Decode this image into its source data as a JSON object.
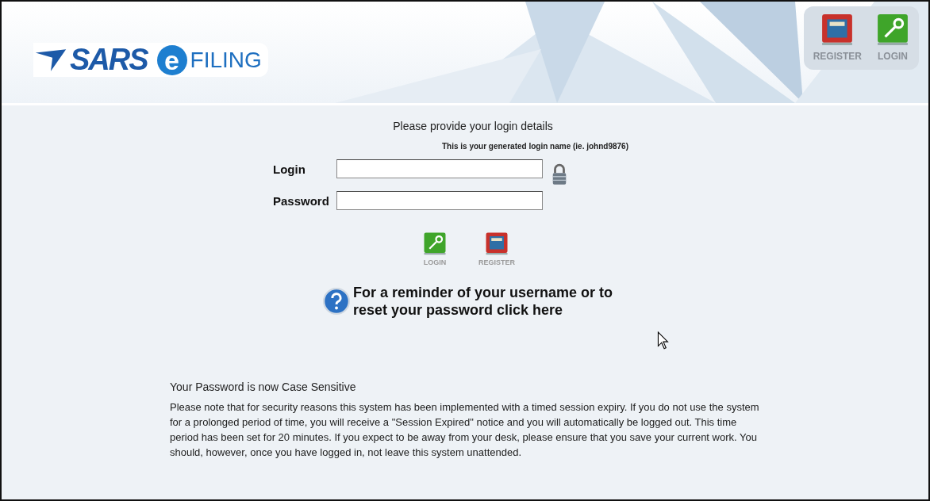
{
  "header": {
    "logo": {
      "brand": "SARS",
      "badge": "e",
      "product": "FILING"
    },
    "nav": [
      {
        "kind": "register",
        "label": "REGISTER"
      },
      {
        "kind": "login",
        "label": "LOGIN"
      }
    ]
  },
  "form": {
    "heading": "Please provide your login details",
    "hint": "This is your generated login name (ie. johnd9876)",
    "fields": [
      {
        "label": "Login",
        "lock": true
      },
      {
        "label": "Password",
        "lock": false
      }
    ],
    "buttons": [
      {
        "kind": "login",
        "label": "LOGIN"
      },
      {
        "kind": "register",
        "label": "REGISTER"
      }
    ],
    "help_link": "For a reminder of your username or to reset your password click here"
  },
  "notice": {
    "title": "Your Password is now Case Sensitive",
    "body": "Please note that for security reasons this system has been implemented with a timed session expiry. If you do not use the system for a prolonged period of time, you will receive a \"Session Expired\" notice and you will automatically be logged out. This time period has been set for 20 minutes. If you expect to be away from your desk, please ensure that you save your current work. You should, however, once you have logged in, not leave this system unattended."
  }
}
